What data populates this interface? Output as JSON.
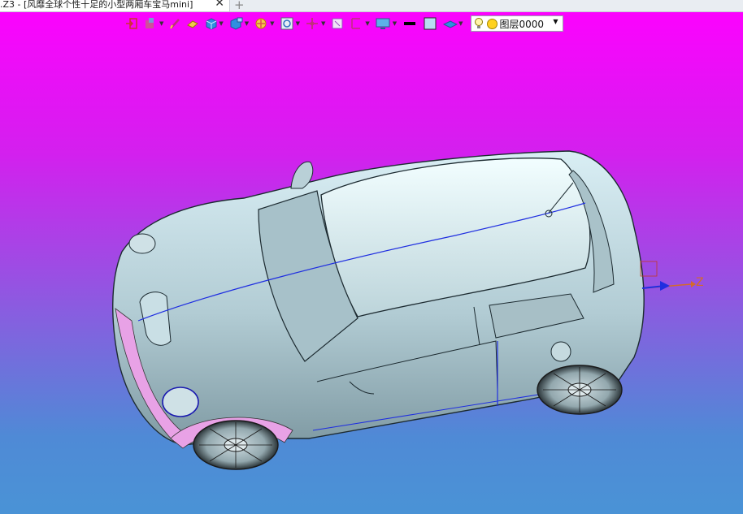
{
  "window": {
    "tab_title": ".Z3 - [风靡全球个性十足的小型两厢车宝马mini]",
    "tab_close_glyph": "✕",
    "new_tab_glyph": "+"
  },
  "toolbar": {
    "icons": [
      "import-icon",
      "save-icon",
      "pencil-icon",
      "eraser-icon",
      "cube-icon",
      "view-cube-icon",
      "render-icon",
      "zoom-fit-icon",
      "pan-icon",
      "select-icon",
      "align-icon",
      "display-icon",
      "line-color-swatch",
      "fill-color-swatch",
      "plane-icon"
    ],
    "layer": {
      "name": "图层0000"
    }
  },
  "viewport": {
    "axis_label": "Z",
    "background_top": "#ff00ff",
    "background_bottom": "#4a93d6"
  }
}
